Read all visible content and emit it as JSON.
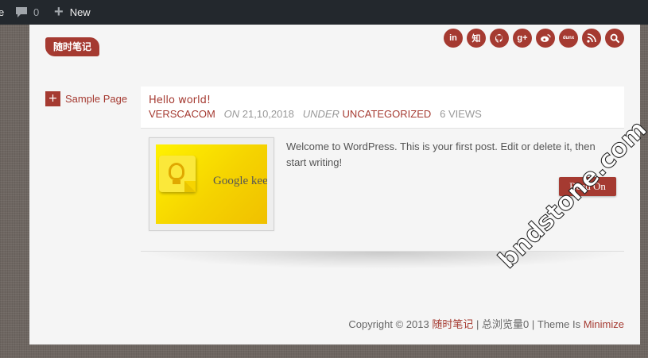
{
  "adminbar": {
    "site_fragment": "e",
    "comments_count": "0",
    "new_label": "New",
    "icons": [
      "comment-icon",
      "plus-icon"
    ]
  },
  "site": {
    "logo": "随时笔记"
  },
  "social": [
    "in",
    "知",
    "",
    "g+",
    "",
    "dunx",
    "",
    ""
  ],
  "social_icons": [
    "linkedin-icon",
    "zhihu-icon",
    "github-icon",
    "google-plus-icon",
    "weibo-icon",
    "dunx-icon",
    "rss-icon",
    "search-icon"
  ],
  "sidebar": {
    "items": [
      {
        "label": "Sample Page"
      }
    ]
  },
  "post": {
    "title": "Hello world!",
    "author": "VERSCACOM",
    "on_label": "ON",
    "date": "21,10,2018",
    "under_label": "UNDER",
    "category": "UNCATEGORIZED",
    "views": "6 VIEWS",
    "excerpt": "Welcome to WordPress. This is your first post. Edit or delete it, then start writing!",
    "read_more": "Read On",
    "thumb_text": "Google kee"
  },
  "footer": {
    "copyright": "Copyright © 2013",
    "site_link": "随时笔记",
    "sep1": "|",
    "views_text": "总浏览量",
    "views_tail": "0",
    "sep2": "|",
    "theme_label": "Theme Is",
    "theme_link": "Minimize"
  },
  "watermark": "bndstone.com",
  "colors": {
    "accent": "#a53a31",
    "adminbar": "#23282d",
    "page_bg": "#f5f5f5"
  }
}
